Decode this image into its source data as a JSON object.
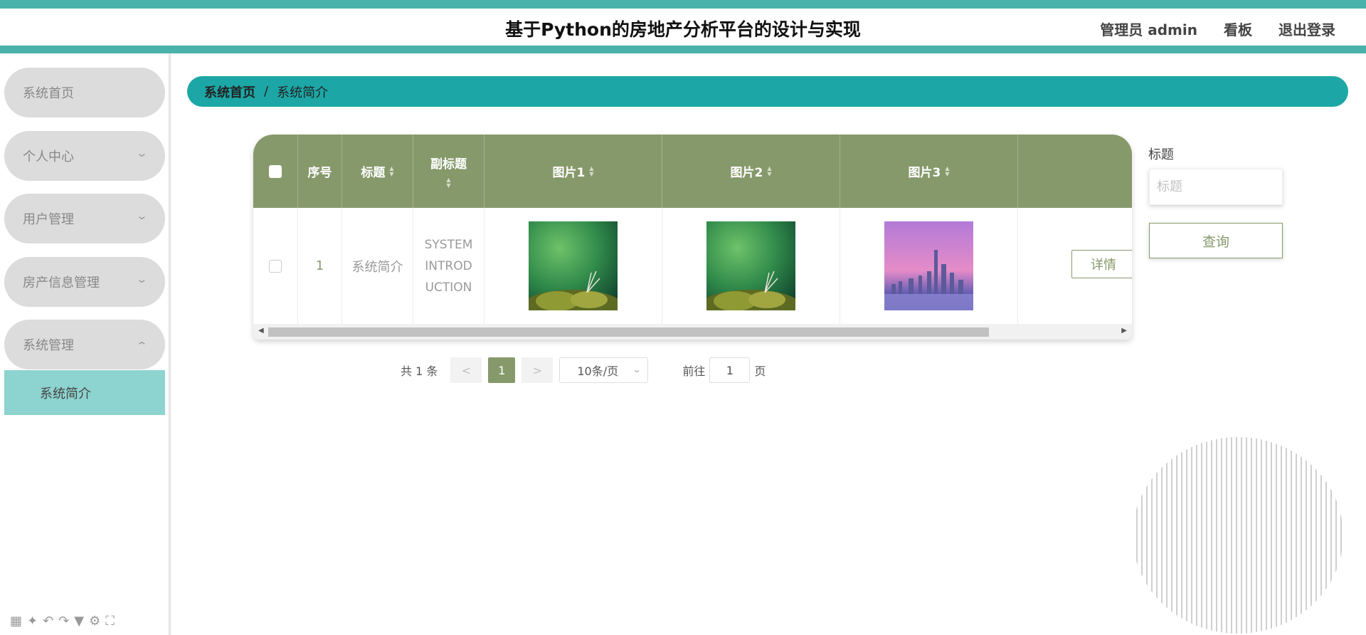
{
  "header": {
    "title": "基于Python的房地产分析平台的设计与实现",
    "user_label": "管理员 admin",
    "dashboard_label": "看板",
    "logout_label": "退出登录"
  },
  "sidebar": {
    "items": [
      {
        "label": "系统首页",
        "has_chevron": false
      },
      {
        "label": "个人中心",
        "chevron": "down"
      },
      {
        "label": "用户管理",
        "chevron": "down"
      },
      {
        "label": "房产信息管理",
        "chevron": "down"
      },
      {
        "label": "系统管理",
        "chevron": "up",
        "expanded": true
      }
    ],
    "submenu": {
      "label": "系统简介",
      "active": true
    }
  },
  "breadcrumb": {
    "home": "系统首页",
    "separator": "/",
    "current": "系统简介"
  },
  "table": {
    "columns": [
      "序号",
      "标题",
      "副标题",
      "图片1",
      "图片2",
      "图片3"
    ],
    "sortable": [
      "标题",
      "副标题",
      "图片1",
      "图片2",
      "图片3"
    ],
    "rows": [
      {
        "index": "1",
        "title": "系统简介",
        "subtitle_lines": [
          "SYSTEM",
          "INTROD",
          "UCTION"
        ],
        "images": [
          "green-plant-image",
          "green-plant-image",
          "city-skyline-image"
        ],
        "action_label": "详情"
      }
    ]
  },
  "search": {
    "label": "标题",
    "placeholder": "标题",
    "button_label": "查询"
  },
  "pagination": {
    "total_text": "共 1 条",
    "prev": "<",
    "current_page": "1",
    "next": ">",
    "page_size": "10条/页",
    "goto_label": "前往",
    "goto_value": "1",
    "page_suffix": "页"
  },
  "colors": {
    "accent": "#49b2ab",
    "breadcrumb_bg": "#1ca7a6",
    "table_header": "#86996b",
    "sidebar_pill": "#dcdcdc",
    "sidebar_active": "#8dd3cf"
  }
}
